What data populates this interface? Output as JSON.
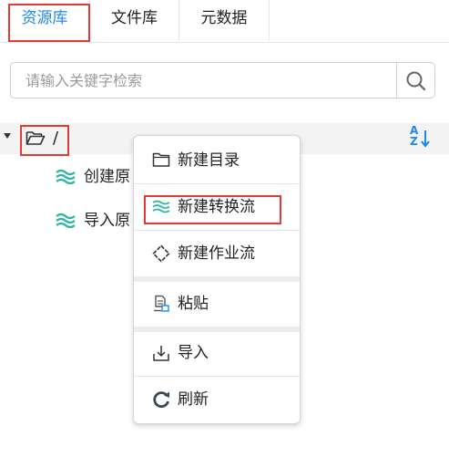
{
  "tabs": [
    {
      "label": "资源库",
      "active": true
    },
    {
      "label": "文件库",
      "active": false
    },
    {
      "label": "元数据",
      "active": false
    }
  ],
  "search": {
    "placeholder": "请输入关键字检索",
    "icon": "search-icon"
  },
  "tree": {
    "root_label": "/",
    "root_icon": "folder-open-icon",
    "sort_icon": "sort-alpha-icon",
    "sort_letters": [
      "A",
      "Z"
    ],
    "children": [
      {
        "label": "创建原",
        "icon": "flow-icon"
      },
      {
        "label": "导入原",
        "icon": "flow-icon"
      }
    ]
  },
  "context_menu": {
    "items": [
      {
        "label": "新建目录",
        "icon": "folder-icon"
      },
      {
        "label": "新建转换流",
        "icon": "flow-icon"
      },
      {
        "label": "新建作业流",
        "icon": "diamond-icon"
      },
      {
        "label": "粘贴",
        "icon": "paste-icon"
      },
      {
        "label": "导入",
        "icon": "import-icon"
      },
      {
        "label": "刷新",
        "icon": "refresh-icon"
      }
    ]
  },
  "colors": {
    "accent": "#1e88e5",
    "flow": "#2bb5a4",
    "highlight_box": "#e53935",
    "text": "#222222"
  }
}
